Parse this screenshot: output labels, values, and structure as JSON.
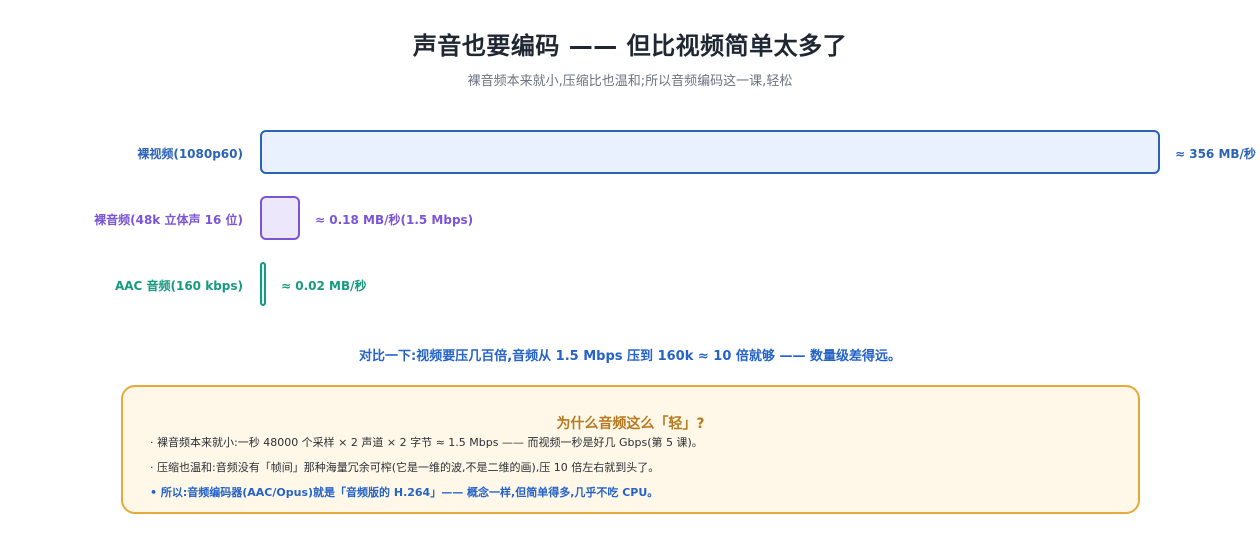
{
  "header": {
    "title": "声音也要编码 —— 但比视频简单太多了",
    "subtitle": "裸音频本来就小,压缩比也温和;所以音频编码这一课,轻松"
  },
  "rows": [
    {
      "label": "裸视频(1080p60)",
      "value": "≈ 356 MB/秒",
      "label_color": "#2b63b5",
      "value_color": "#2b63b5",
      "fill": "#e8f1fd",
      "stroke": "#2b63b5"
    },
    {
      "label": "裸音频(48k 立体声 16 位)",
      "value": "≈ 0.18 MB/秒(1.5 Mbps)",
      "label_color": "#7b55d6",
      "value_color": "#7b55d6",
      "fill": "#ede7fb",
      "stroke": "#7b55d6"
    },
    {
      "label": "AAC 音频(160 kbps)",
      "value": "≈ 0.02 MB/秒",
      "label_color": "#179a7e",
      "value_color": "#179a7e",
      "fill": "#e3f6f0",
      "stroke": "#179a7e"
    }
  ],
  "compare_text": "对比一下:视频要压几百倍,音频从 1.5 Mbps 压到 160k ≈ 10 倍就够 —— 数量级差得远。",
  "panel": {
    "title": "为什么音频这么「轻」?",
    "lines": [
      "· 裸音频本来就小:一秒 48000 个采样 × 2 声道 × 2 字节 ≈ 1.5 Mbps —— 而视频一秒是好几 Gbps(第 5 课)。",
      "· 压缩也温和:音频没有「帧间」那种海量冗余可榨(它是一维的波,不是二维的画),压 10 倍左右就到头了。",
      "• 所以:音频编码器(AAC/Opus)就是「音频版的 H.264」—— 概念一样,但简单得多,几乎不吃 CPU。"
    ]
  }
}
